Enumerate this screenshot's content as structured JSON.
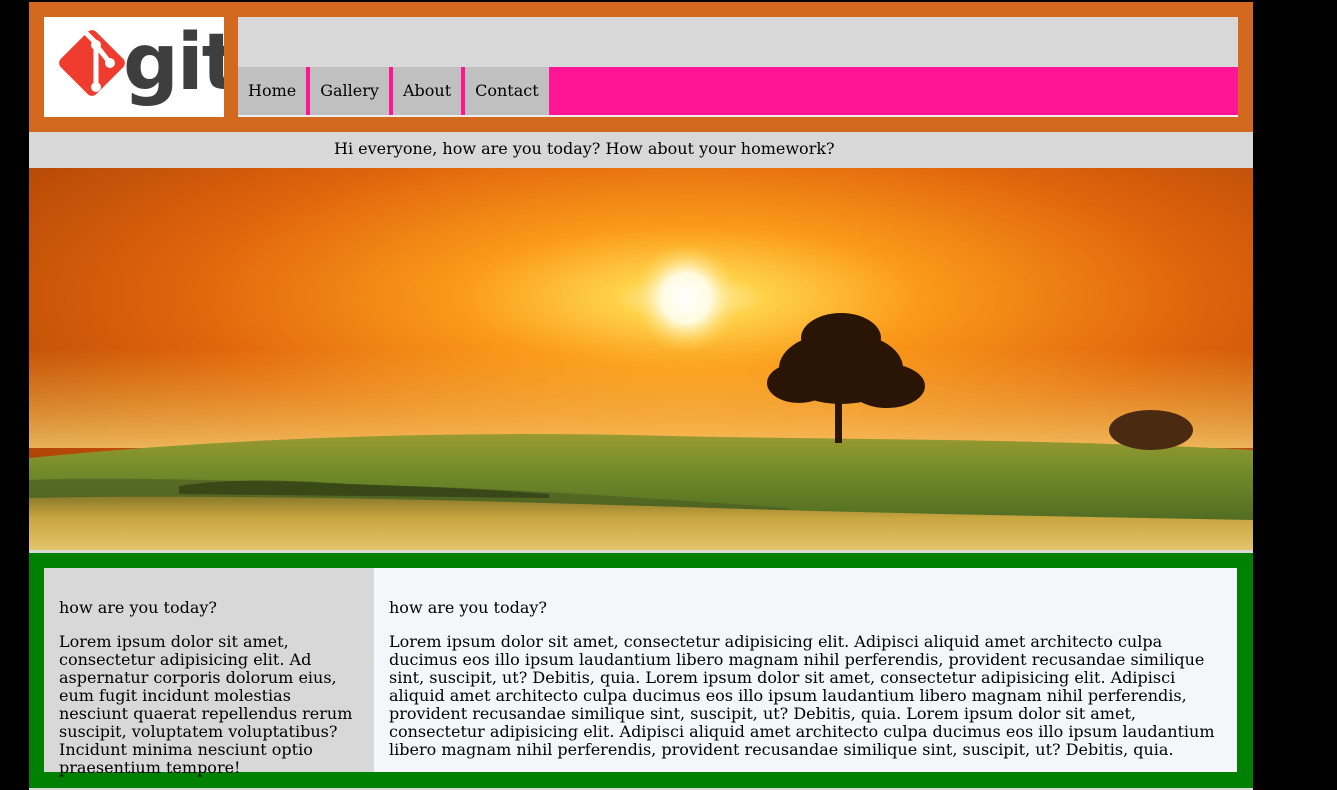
{
  "header": {
    "logo_text": "git",
    "nav": [
      "Home",
      "Gallery",
      "About",
      "Contact"
    ]
  },
  "greeting": "Hi everyone, how are you today? How about your homework?",
  "hero": {
    "image": "sunset-landscape"
  },
  "left_column": {
    "title": "how are you today?",
    "body": "Lorem ipsum dolor sit amet, consectetur adipisicing elit. Ad aspernatur corporis dolorum eius, eum fugit incidunt molestias nesciunt quaerat repellendus rerum suscipit, voluptatem voluptatibus? Incidunt minima nesciunt optio praesentium tempore!"
  },
  "right_column": {
    "title": "how are you today?",
    "body": "Lorem ipsum dolor sit amet, consectetur adipisicing elit. Adipisci aliquid amet architecto culpa ducimus eos illo ipsum laudantium libero magnam nihil perferendis, provident recusandae similique sint, suscipit, ut? Debitis, quia. Lorem ipsum dolor sit amet, consectetur adipisicing elit. Adipisci aliquid amet architecto culpa ducimus eos illo ipsum laudantium libero magnam nihil perferendis, provident recusandae similique sint, suscipit, ut? Debitis, quia. Lorem ipsum dolor sit amet, consectetur adipisicing elit. Adipisci aliquid amet architecto culpa ducimus eos illo ipsum laudantium libero magnam nihil perferendis, provident recusandae similique sint, suscipit, ut? Debitis, quia."
  },
  "colors": {
    "header_bg": "#d2691e",
    "nav_bar": "#ff1493",
    "nav_item": "#c0c0c0",
    "content_border": "#008000",
    "page_bg": "#d8d8d8",
    "right_col_bg": "#f5f6fa",
    "git_logo": "#f03c2e"
  }
}
